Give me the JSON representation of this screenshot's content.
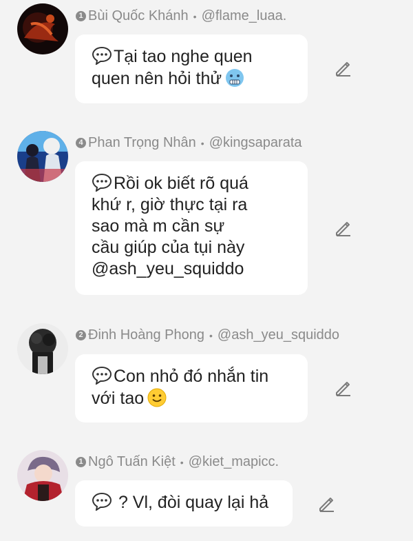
{
  "comments": [
    {
      "rank": "1",
      "name": "Bùi Quốc Khánh",
      "handle": "@flame_luaa.",
      "lines": [
        "Tại tao nghe quen",
        "quen nên hỏi thử"
      ],
      "emoji": "cold-face-icon",
      "avatar": "avatar-dark-red"
    },
    {
      "rank": "4",
      "name": "Phan Trọng Nhân",
      "handle": "@kingsaparata",
      "lines": [
        "Rồi ok biết rõ quá",
        "khứ r, giờ thực tại ra",
        "sao mà m cần sự",
        "cầu giúp của tụi này",
        "@ash_yeu_squiddo"
      ],
      "emoji": "",
      "avatar": "avatar-blue"
    },
    {
      "rank": "2",
      "name": "Đinh Hoàng Phong",
      "handle": "@ash_yeu_squiddo",
      "lines": [
        "Con nhỏ đó nhắn tin",
        "với tao"
      ],
      "emoji": "slight-smile-icon",
      "avatar": "avatar-gray"
    },
    {
      "rank": "1",
      "name": "Ngô Tuấn Kiệt",
      "handle": "@kiet_mapicc.",
      "lines": [
        " ? Vl, đòi quay lại hả"
      ],
      "emoji": "",
      "avatar": "avatar-red-anime"
    }
  ]
}
